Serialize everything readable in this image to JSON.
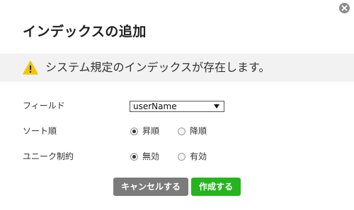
{
  "dialog": {
    "title": "インデックスの追加",
    "close_icon": "close-icon"
  },
  "alert": {
    "icon": "warning-icon",
    "icon_color": "#f2c600",
    "message": "システム規定のインデックスが存在します。"
  },
  "form": {
    "field": {
      "label": "フィールド",
      "selected_value": "userName"
    },
    "sort": {
      "label": "ソート順",
      "options": [
        {
          "label": "昇順",
          "checked": true
        },
        {
          "label": "降順",
          "checked": false
        }
      ]
    },
    "unique": {
      "label": "ユニーク制約",
      "options": [
        {
          "label": "無効",
          "checked": true
        },
        {
          "label": "有効",
          "checked": false
        }
      ]
    }
  },
  "buttons": {
    "cancel_label": "キャンセルする",
    "cancel_color": "#7b7b7b",
    "create_label": "作成する",
    "create_color": "#27b51f"
  }
}
